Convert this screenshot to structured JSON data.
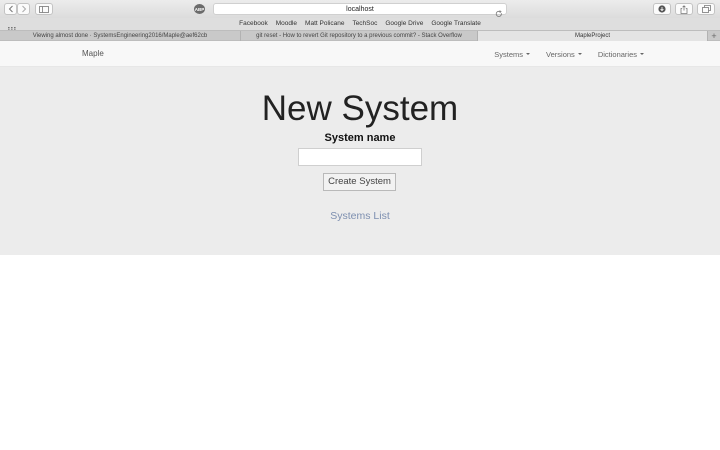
{
  "browser": {
    "url": "localhost",
    "ad_icon_text": "ABP",
    "favorites": [
      "Facebook",
      "Moodle",
      "Matt Policane",
      "TechSoc",
      "Google Drive",
      "Google Translate"
    ],
    "tabs": [
      {
        "label": "Viewing almost done · SystemsEngineering2016/Maple@aef62cb",
        "active": false
      },
      {
        "label": "git reset - How to revert Git repository to a previous commit? - Stack Overflow",
        "active": false
      },
      {
        "label": "MapleProject",
        "active": true
      }
    ],
    "new_tab_label": "+"
  },
  "navbar": {
    "brand": "Maple",
    "menus": [
      "Systems",
      "Versions",
      "Dictionaries"
    ]
  },
  "main": {
    "title": "New System",
    "field_label": "System name",
    "name_input_value": "",
    "name_input_placeholder": "",
    "create_button": "Create System",
    "list_link": "Systems List"
  },
  "colors": {
    "navbar_bg": "#f8f8f8",
    "jumbotron_bg": "#ececec",
    "link": "#7d8fb0"
  }
}
